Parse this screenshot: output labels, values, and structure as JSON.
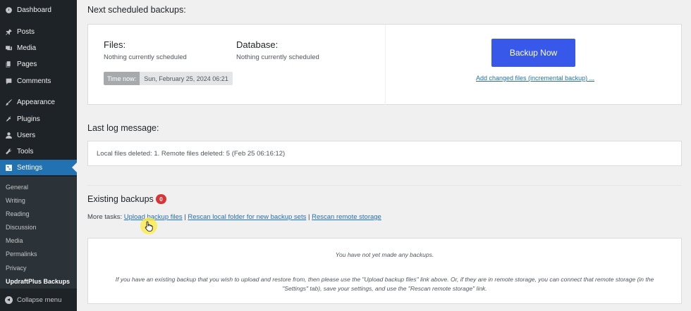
{
  "sidebar": {
    "items": [
      {
        "label": "Dashboard",
        "icon": "dashboard-icon"
      },
      {
        "label": "Posts",
        "icon": "pin-icon"
      },
      {
        "label": "Media",
        "icon": "media-icon"
      },
      {
        "label": "Pages",
        "icon": "pages-icon"
      },
      {
        "label": "Comments",
        "icon": "comment-icon"
      },
      {
        "label": "Appearance",
        "icon": "brush-icon"
      },
      {
        "label": "Plugins",
        "icon": "plug-icon"
      },
      {
        "label": "Users",
        "icon": "user-icon"
      },
      {
        "label": "Tools",
        "icon": "wrench-icon"
      },
      {
        "label": "Settings",
        "icon": "settings-icon"
      }
    ],
    "submenu": [
      "General",
      "Writing",
      "Reading",
      "Discussion",
      "Media",
      "Permalinks",
      "Privacy",
      "UpdraftPlus Backups"
    ],
    "collapse_label": "Collapse menu"
  },
  "scheduled": {
    "heading": "Next scheduled backups:",
    "files_title": "Files:",
    "files_status": "Nothing currently scheduled",
    "db_title": "Database:",
    "db_status": "Nothing currently scheduled",
    "time_label": "Time now:",
    "time_value": "Sun, February 25, 2024 06:21",
    "backup_button": "Backup Now",
    "incremental_link": "Add changed files (incremental backup) ..."
  },
  "log": {
    "heading": "Last log message:",
    "message": "Local files deleted: 1. Remote files deleted: 5 (Feb 25 06:16:12)"
  },
  "existing": {
    "heading": "Existing backups",
    "count": "0",
    "tasks_label": "More tasks:",
    "upload_link": "Upload backup files",
    "rescan_local_link": "Rescan local folder for new backup sets",
    "rescan_remote_link": "Rescan remote storage",
    "separator": "|",
    "empty_line1": "You have not yet made any backups.",
    "empty_line2": "If you have an existing backup that you wish to upload and restore from, then please use the \"Upload backup files\" link above. Or, if they are in remote storage, you can connect that remote storage (in the \"Settings\" tab), save your settings, and use the \"Rescan remote storage\" link."
  },
  "colors": {
    "sidebar_bg": "#1d2327",
    "active_menu": "#2271b1",
    "primary_button": "#3858e9",
    "link": "#2271b1",
    "badge": "#d63638"
  }
}
